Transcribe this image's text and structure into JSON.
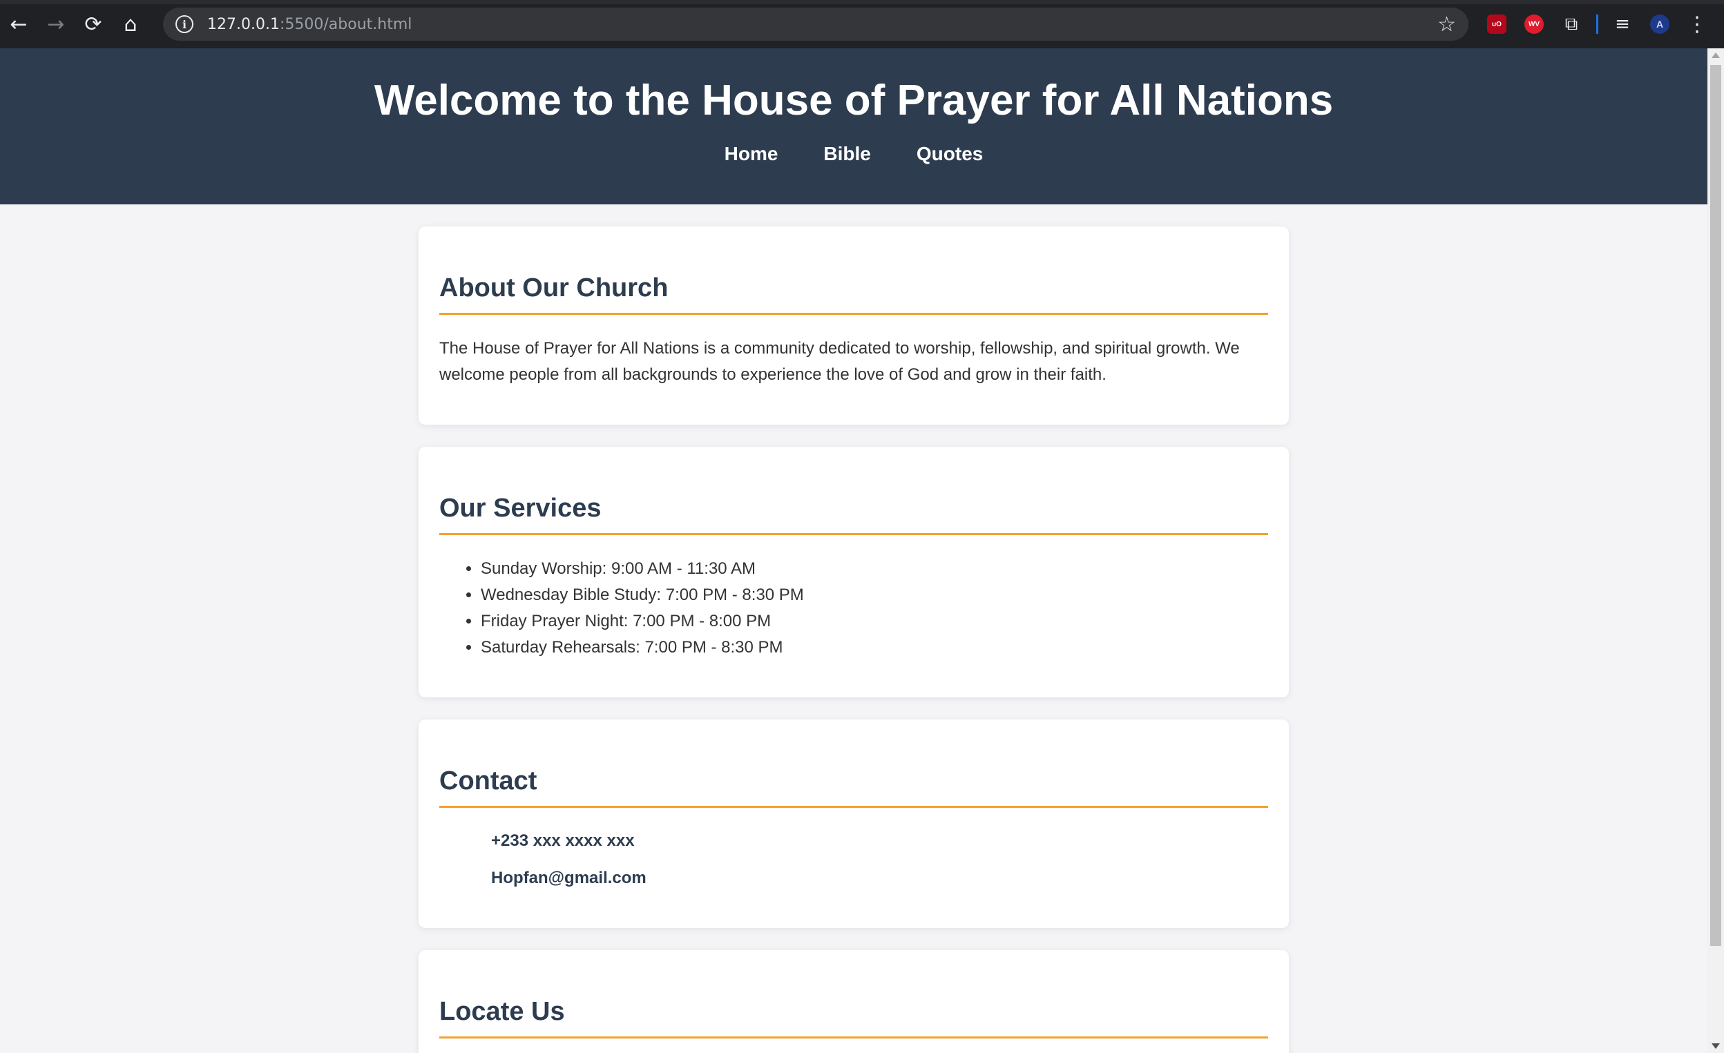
{
  "browser": {
    "url_host": "127.0.0.1",
    "url_rest": ":5500/about.html",
    "icons": {
      "back": "←",
      "forward": "→",
      "reload": "⟳",
      "home": "⌂",
      "info": "i",
      "star": "☆",
      "extensions": "⧉",
      "media": "≡",
      "menu": "⋮"
    },
    "extension_labels": {
      "ublock": "uO",
      "wv": "WV",
      "avatar": "A"
    }
  },
  "header": {
    "title": "Welcome to the House of Prayer for All Nations",
    "nav": [
      "Home",
      "Bible",
      "Quotes"
    ]
  },
  "sections": {
    "about": {
      "heading": "About Our Church",
      "body": "The House of Prayer for All Nations is a community dedicated to worship, fellowship, and spiritual growth. We welcome people from all backgrounds to experience the love of God and grow in their faith."
    },
    "services": {
      "heading": "Our Services",
      "items": [
        "Sunday Worship: 9:00 AM - 11:30 AM",
        "Wednesday Bible Study: 7:00 PM - 8:30 PM",
        "Friday Prayer Night: 7:00 PM - 8:00 PM",
        "Saturday Rehearsals: 7:00 PM - 8:30 PM"
      ]
    },
    "contact": {
      "heading": "Contact",
      "phone": "+233 xxx xxxx xxx",
      "email": "Hopfan@gmail.com"
    },
    "locate": {
      "heading": "Locate Us"
    }
  },
  "colors": {
    "header_bg": "#2d3c4f",
    "accent": "#f5a030",
    "page_bg": "#f4f4f7"
  }
}
